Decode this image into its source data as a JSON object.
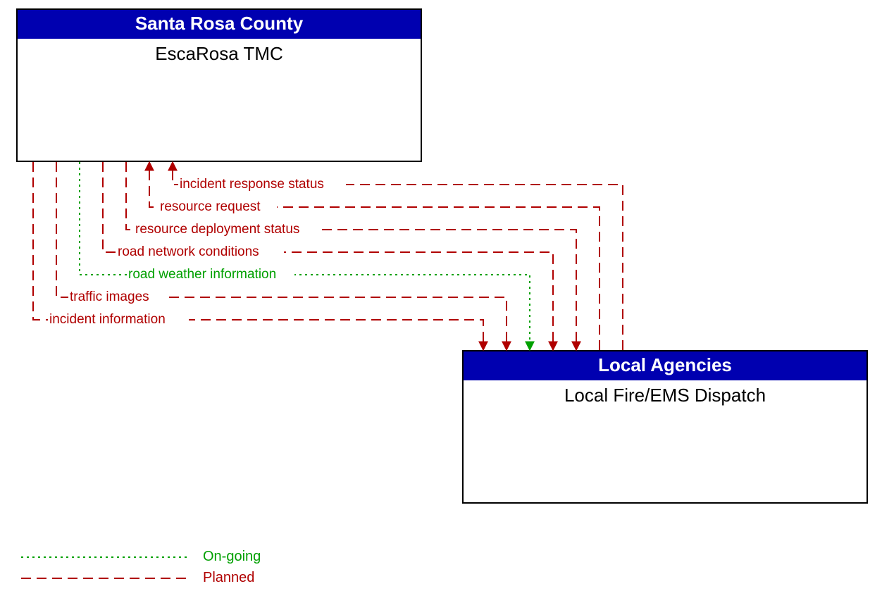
{
  "boxes": {
    "top": {
      "header": "Santa Rosa County",
      "body": "EscaRosa TMC"
    },
    "bottom": {
      "header": "Local Agencies",
      "body": "Local Fire/EMS Dispatch"
    }
  },
  "flows": {
    "incident_response_status": "incident response status",
    "resource_request": "resource request",
    "resource_deployment_status": "resource deployment status",
    "road_network_conditions": "road network conditions",
    "road_weather_information": "road weather information",
    "traffic_images": "traffic images",
    "incident_information": "incident information"
  },
  "legend": {
    "ongoing": "On-going",
    "planned": "Planned"
  },
  "colors": {
    "header_bg": "#0000b0",
    "planned": "#b00000",
    "ongoing": "#00a000"
  }
}
